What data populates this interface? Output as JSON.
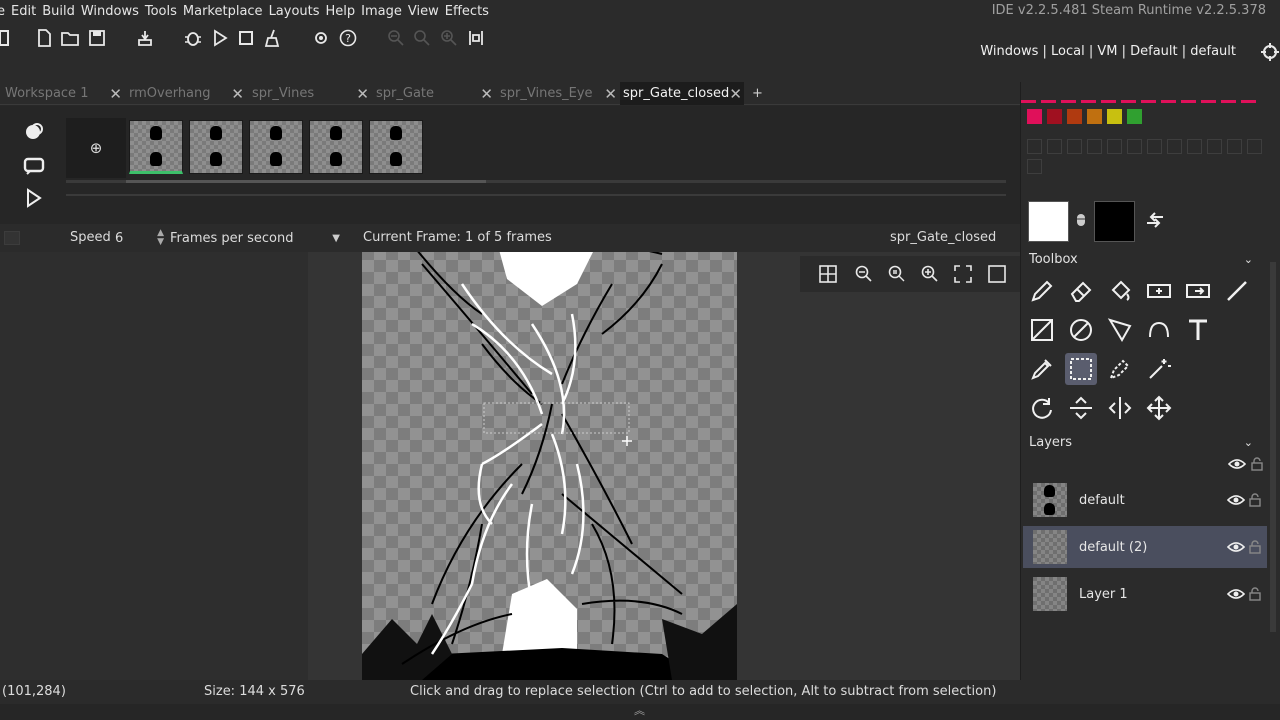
{
  "menubar": {
    "items": [
      "e",
      "Edit",
      "Build",
      "Windows",
      "Tools",
      "Marketplace",
      "Layouts",
      "Help",
      "Image",
      "View",
      "Effects"
    ],
    "version_text": "IDE v2.2.5.481 Steam  Runtime v2.2.5.378"
  },
  "toolbar": {
    "target_info": "Windows | Local | VM | Default | default",
    "icons": [
      "new-project-icon",
      "open-project-icon",
      "save-icon",
      "create-executable-icon",
      "debug-icon",
      "run-icon",
      "stop-icon",
      "clean-icon",
      "game-options-icon",
      "help-icon",
      "zoom-out-icon",
      "zoom-reset-icon",
      "zoom-in-icon",
      "gamepad-icon"
    ]
  },
  "tabs": [
    {
      "label": "Workspace 1",
      "active": false
    },
    {
      "label": "rmOverhang",
      "active": false
    },
    {
      "label": "spr_Vines",
      "active": false
    },
    {
      "label": "spr_Gate",
      "active": false
    },
    {
      "label": "spr_Vines_Eye",
      "active": false
    },
    {
      "label": "spr_Gate_closed",
      "active": true
    }
  ],
  "tab_add": "+",
  "animation": {
    "frame_count": 5,
    "speed_label": "Speed:",
    "speed_value": "6",
    "speed_unit": "Frames per second",
    "current_frame": "Current Frame: 1 of 5 frames",
    "sprite_name": "spr_Gate_closed"
  },
  "palette": {
    "colors": [
      "#e0105a",
      "#a01020",
      "#b03a10",
      "#c07010",
      "#c8c010",
      "#30a030"
    ],
    "primary_color": "#ffffff",
    "secondary_color": "#000000"
  },
  "toolbox": {
    "title": "Toolbox",
    "tools": [
      "pencil-icon",
      "eraser-icon",
      "fill-icon",
      "copy-brush-icon",
      "paste-brush-icon",
      "line-icon",
      "rectangle-icon",
      "ellipse-icon",
      "polygon-icon",
      "arc-icon",
      "text-icon",
      "color-picker-icon",
      "select-rectangle-icon",
      "select-brush-icon",
      "magic-wand-icon",
      "rotate-icon",
      "flip-vertical-icon",
      "flip-horizontal-icon",
      "move-icon"
    ],
    "selected_tool": "select-rectangle-icon"
  },
  "layers": {
    "title": "Layers",
    "items": [
      {
        "name": "default",
        "selected": false
      },
      {
        "name": "default (2)",
        "selected": true
      },
      {
        "name": "Layer 1",
        "selected": false
      }
    ]
  },
  "status": {
    "coords": "(101,284)",
    "size": "Size: 144 x 576",
    "hint": "Click and drag to replace selection (Ctrl to add to selection, Alt to subtract from selection)"
  }
}
